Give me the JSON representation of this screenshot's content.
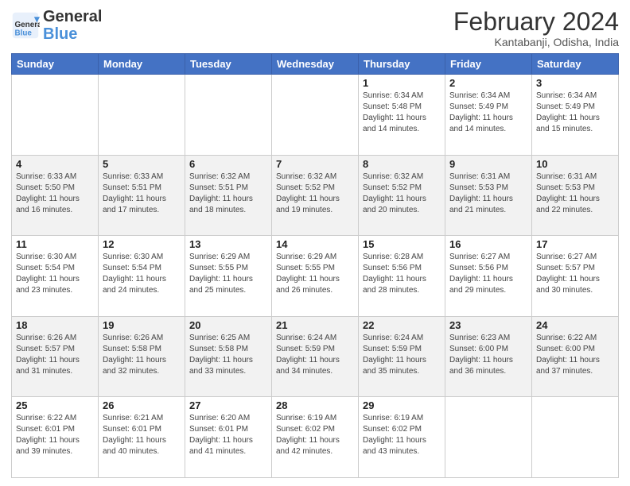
{
  "header": {
    "logo_general": "General",
    "logo_blue": "Blue",
    "title": "February 2024",
    "location": "Kantabanji, Odisha, India"
  },
  "days_of_week": [
    "Sunday",
    "Monday",
    "Tuesday",
    "Wednesday",
    "Thursday",
    "Friday",
    "Saturday"
  ],
  "weeks": [
    [
      {
        "day": "",
        "info": ""
      },
      {
        "day": "",
        "info": ""
      },
      {
        "day": "",
        "info": ""
      },
      {
        "day": "",
        "info": ""
      },
      {
        "day": "1",
        "info": "Sunrise: 6:34 AM\nSunset: 5:48 PM\nDaylight: 11 hours\nand 14 minutes."
      },
      {
        "day": "2",
        "info": "Sunrise: 6:34 AM\nSunset: 5:49 PM\nDaylight: 11 hours\nand 14 minutes."
      },
      {
        "day": "3",
        "info": "Sunrise: 6:34 AM\nSunset: 5:49 PM\nDaylight: 11 hours\nand 15 minutes."
      }
    ],
    [
      {
        "day": "4",
        "info": "Sunrise: 6:33 AM\nSunset: 5:50 PM\nDaylight: 11 hours\nand 16 minutes."
      },
      {
        "day": "5",
        "info": "Sunrise: 6:33 AM\nSunset: 5:51 PM\nDaylight: 11 hours\nand 17 minutes."
      },
      {
        "day": "6",
        "info": "Sunrise: 6:32 AM\nSunset: 5:51 PM\nDaylight: 11 hours\nand 18 minutes."
      },
      {
        "day": "7",
        "info": "Sunrise: 6:32 AM\nSunset: 5:52 PM\nDaylight: 11 hours\nand 19 minutes."
      },
      {
        "day": "8",
        "info": "Sunrise: 6:32 AM\nSunset: 5:52 PM\nDaylight: 11 hours\nand 20 minutes."
      },
      {
        "day": "9",
        "info": "Sunrise: 6:31 AM\nSunset: 5:53 PM\nDaylight: 11 hours\nand 21 minutes."
      },
      {
        "day": "10",
        "info": "Sunrise: 6:31 AM\nSunset: 5:53 PM\nDaylight: 11 hours\nand 22 minutes."
      }
    ],
    [
      {
        "day": "11",
        "info": "Sunrise: 6:30 AM\nSunset: 5:54 PM\nDaylight: 11 hours\nand 23 minutes."
      },
      {
        "day": "12",
        "info": "Sunrise: 6:30 AM\nSunset: 5:54 PM\nDaylight: 11 hours\nand 24 minutes."
      },
      {
        "day": "13",
        "info": "Sunrise: 6:29 AM\nSunset: 5:55 PM\nDaylight: 11 hours\nand 25 minutes."
      },
      {
        "day": "14",
        "info": "Sunrise: 6:29 AM\nSunset: 5:55 PM\nDaylight: 11 hours\nand 26 minutes."
      },
      {
        "day": "15",
        "info": "Sunrise: 6:28 AM\nSunset: 5:56 PM\nDaylight: 11 hours\nand 28 minutes."
      },
      {
        "day": "16",
        "info": "Sunrise: 6:27 AM\nSunset: 5:56 PM\nDaylight: 11 hours\nand 29 minutes."
      },
      {
        "day": "17",
        "info": "Sunrise: 6:27 AM\nSunset: 5:57 PM\nDaylight: 11 hours\nand 30 minutes."
      }
    ],
    [
      {
        "day": "18",
        "info": "Sunrise: 6:26 AM\nSunset: 5:57 PM\nDaylight: 11 hours\nand 31 minutes."
      },
      {
        "day": "19",
        "info": "Sunrise: 6:26 AM\nSunset: 5:58 PM\nDaylight: 11 hours\nand 32 minutes."
      },
      {
        "day": "20",
        "info": "Sunrise: 6:25 AM\nSunset: 5:58 PM\nDaylight: 11 hours\nand 33 minutes."
      },
      {
        "day": "21",
        "info": "Sunrise: 6:24 AM\nSunset: 5:59 PM\nDaylight: 11 hours\nand 34 minutes."
      },
      {
        "day": "22",
        "info": "Sunrise: 6:24 AM\nSunset: 5:59 PM\nDaylight: 11 hours\nand 35 minutes."
      },
      {
        "day": "23",
        "info": "Sunrise: 6:23 AM\nSunset: 6:00 PM\nDaylight: 11 hours\nand 36 minutes."
      },
      {
        "day": "24",
        "info": "Sunrise: 6:22 AM\nSunset: 6:00 PM\nDaylight: 11 hours\nand 37 minutes."
      }
    ],
    [
      {
        "day": "25",
        "info": "Sunrise: 6:22 AM\nSunset: 6:01 PM\nDaylight: 11 hours\nand 39 minutes."
      },
      {
        "day": "26",
        "info": "Sunrise: 6:21 AM\nSunset: 6:01 PM\nDaylight: 11 hours\nand 40 minutes."
      },
      {
        "day": "27",
        "info": "Sunrise: 6:20 AM\nSunset: 6:01 PM\nDaylight: 11 hours\nand 41 minutes."
      },
      {
        "day": "28",
        "info": "Sunrise: 6:19 AM\nSunset: 6:02 PM\nDaylight: 11 hours\nand 42 minutes."
      },
      {
        "day": "29",
        "info": "Sunrise: 6:19 AM\nSunset: 6:02 PM\nDaylight: 11 hours\nand 43 minutes."
      },
      {
        "day": "",
        "info": ""
      },
      {
        "day": "",
        "info": ""
      }
    ]
  ]
}
